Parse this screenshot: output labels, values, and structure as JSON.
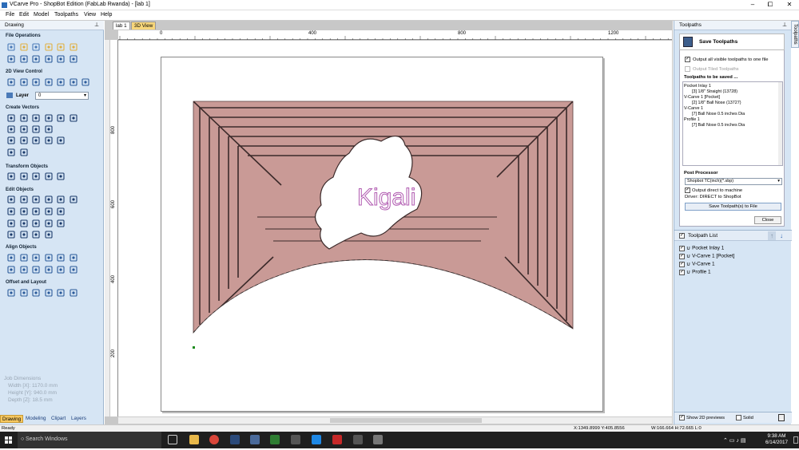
{
  "window": {
    "title": "VCarve Pro - ShopBot Edition (FabLab Rwanda) - [lab 1]",
    "min": "–",
    "max": "⧠",
    "close": "✕"
  },
  "menu": [
    "File",
    "Edit",
    "Model",
    "Toolpaths",
    "View",
    "Help"
  ],
  "left_panel": {
    "title": "Drawing",
    "pin": "⊥",
    "sections": {
      "file_ops": "File Operations",
      "view_control": "2D View Control",
      "create_vectors": "Create Vectors",
      "transform": "Transform Objects",
      "edit": "Edit Objects",
      "align": "Align Objects",
      "offset": "Offset and Layout"
    },
    "layer": {
      "label": "Layer",
      "value": "0"
    },
    "job_dimensions": {
      "title": "Job Dimensions",
      "width": "Width  [X]: 1170.0 mm",
      "height": "Height [Y]: 940.0 mm",
      "depth": "Depth  [Z]: 18.5 mm"
    },
    "tabs": [
      "Drawing",
      "Modeling",
      "Clipart",
      "Layers"
    ],
    "active_tab": "Drawing"
  },
  "document": {
    "tabs": [
      "lab 1",
      "3D View"
    ],
    "ruler_top": [
      "0",
      "400",
      "800",
      "1200"
    ],
    "ruler_left": [
      "800",
      "600",
      "400",
      "200"
    ],
    "design_text": "Kigali",
    "colors": {
      "toolpath": "#c99a96",
      "stroke": "#3b2a2a",
      "text": "#b05ab0"
    }
  },
  "right_panel": {
    "title": "Toolpaths",
    "save_title": "Save Toolpaths",
    "opt_one_file": "Output all visible toolpaths to one file",
    "opt_tiled": "Output Tiled Toolpaths",
    "to_be_saved_label": "Toolpaths to be saved ...",
    "to_be_saved": [
      "Pocket Inlay 1",
      "    [3] 1/8\" Straight (13728)",
      "V-Carve 1 [Pocket]",
      "    [2] 1/8\" Ball Nose (13727)",
      "V-Carve 1",
      "    [7] Ball Nose 0.5 inches Dia",
      "Profile 1",
      "    [7] Ball Nose 0.5 inches Dia"
    ],
    "post_processor_label": "Post Processor",
    "post_processor": "Shopbot TC(inch)(*.sbp)",
    "output_direct": "Output direct to machine",
    "driver": "Driver: DIRECT to ShopBot",
    "save_button": "Save Toolpath(s) to File",
    "close_button": "Close",
    "toolpath_list_label": "Toolpath List",
    "toolpath_list": [
      "Pocket Inlay 1",
      "V-Carve 1 [Pocket]",
      "V-Carve 1",
      "Profile 1"
    ],
    "show_2d": "Show 2D previews",
    "solid": "Solid"
  },
  "side_tab": "Toolpaths",
  "status": {
    "left": "Ready",
    "coords": "X:1349.8999 Y:405.8556",
    "size": "W:166.664  H:72.665  L:0"
  },
  "taskbar": {
    "search": "Search Windows",
    "time": "9:38 AM",
    "date": "6/14/2017"
  }
}
